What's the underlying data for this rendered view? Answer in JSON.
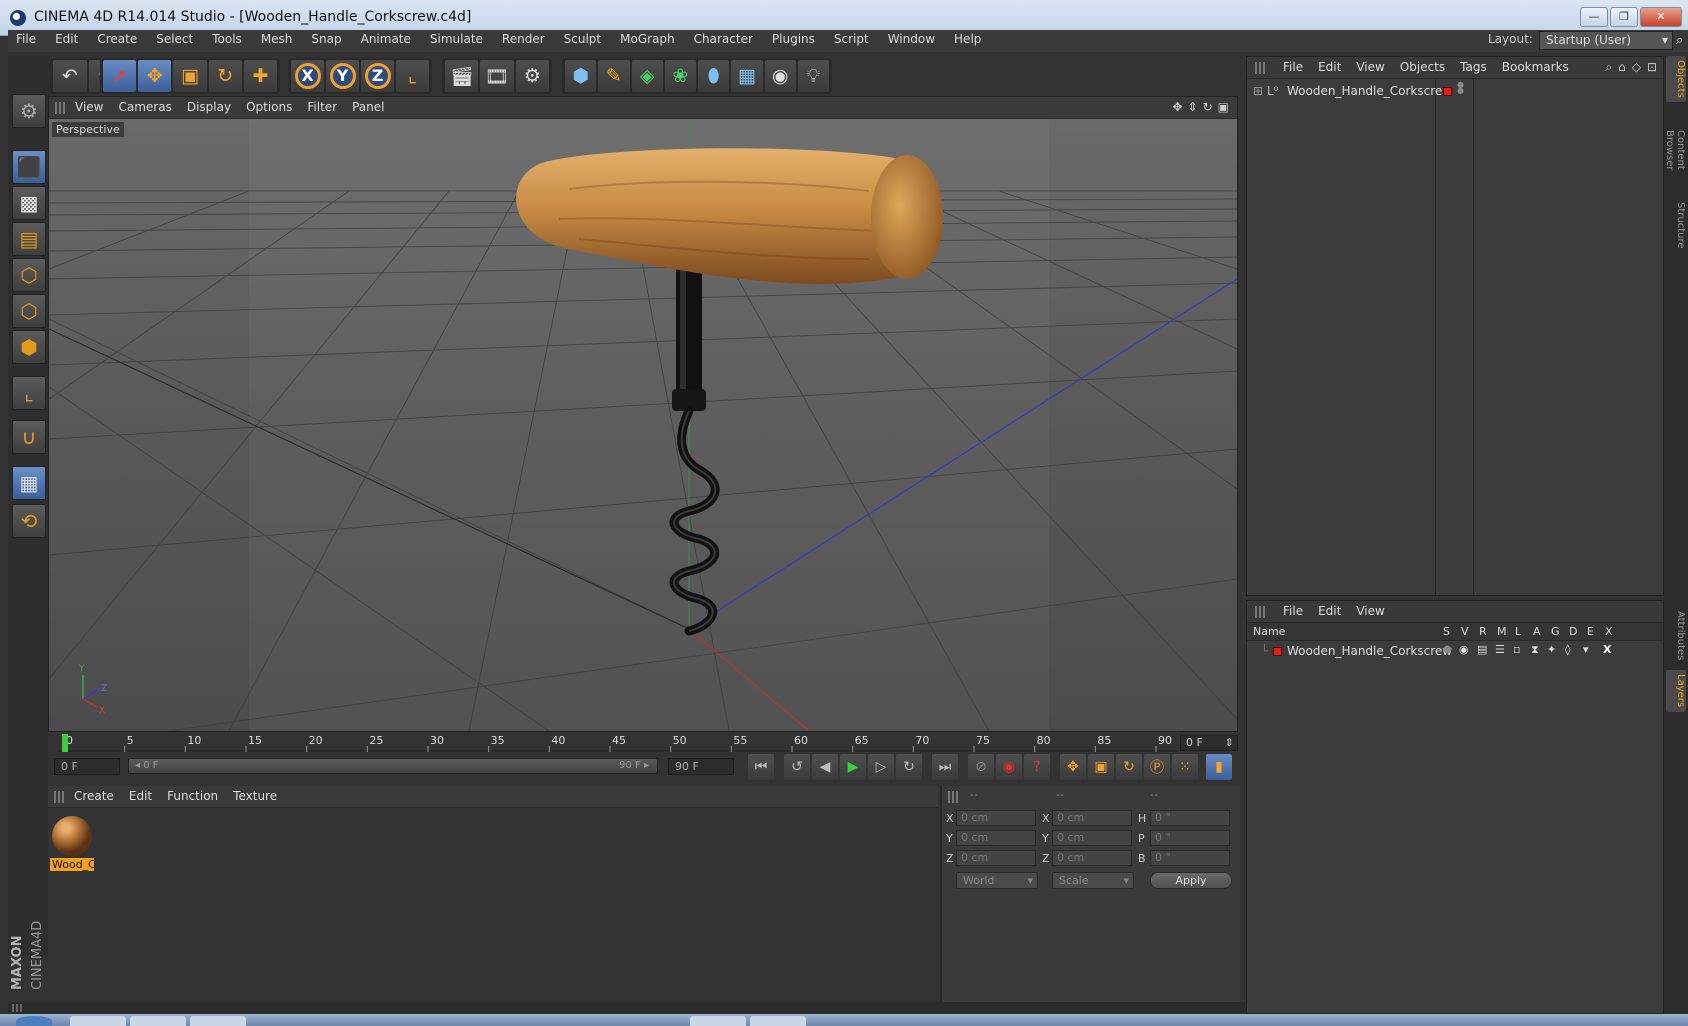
{
  "window": {
    "title": "CINEMA 4D R14.014 Studio - [Wooden_Handle_Corkscrew.c4d]",
    "buttons": [
      "—",
      "❐",
      "✕"
    ]
  },
  "menubar": {
    "items": [
      "File",
      "Edit",
      "Create",
      "Select",
      "Tools",
      "Mesh",
      "Snap",
      "Animate",
      "Simulate",
      "Render",
      "Sculpt",
      "MoGraph",
      "Character",
      "Plugins",
      "Script",
      "Window",
      "Help"
    ],
    "layout_label": "Layout:",
    "layout_value": "Startup (User)"
  },
  "toolbar": {
    "undo_icon": "↶",
    "redo_icon": "↷",
    "axis_x": "X",
    "axis_y": "Y",
    "axis_z": "Z"
  },
  "viewport": {
    "menu": [
      "View",
      "Cameras",
      "Display",
      "Options",
      "Filter",
      "Panel"
    ],
    "camera_label": "Perspective",
    "axis_y": "Y",
    "axis_z": "Z",
    "axis_x": "X"
  },
  "timeline": {
    "ticks": [
      "0",
      "5",
      "10",
      "15",
      "20",
      "25",
      "30",
      "35",
      "40",
      "45",
      "50",
      "55",
      "60",
      "65",
      "70",
      "75",
      "80",
      "85",
      "90"
    ],
    "current_frame": "0 F",
    "start_field": "0 F",
    "range_start": "◂ 0 F",
    "range_end": "90 F ▸",
    "end_field": "90 F"
  },
  "material_manager": {
    "menu": [
      "Create",
      "Edit",
      "Function",
      "Texture"
    ],
    "materials": [
      {
        "name": "Wood_C"
      }
    ]
  },
  "coordinates": {
    "headers": [
      "--",
      "--",
      "--"
    ],
    "rows": [
      {
        "p_label": "X",
        "p_value": "0 cm",
        "s_label": "X",
        "s_value": "0 cm",
        "r_label": "H",
        "r_value": "0 °"
      },
      {
        "p_label": "Y",
        "p_value": "0 cm",
        "s_label": "Y",
        "s_value": "0 cm",
        "r_label": "P",
        "r_value": "0 °"
      },
      {
        "p_label": "Z",
        "p_value": "0 cm",
        "s_label": "Z",
        "s_value": "0 cm",
        "r_label": "B",
        "r_value": "0 °"
      }
    ],
    "space": "World",
    "mode": "Scale",
    "apply": "Apply"
  },
  "object_manager": {
    "menu": [
      "File",
      "Edit",
      "View",
      "Objects",
      "Tags",
      "Bookmarks"
    ],
    "objects": [
      {
        "name": "Wooden_Handle_Corkscrew",
        "layer_color": "#e02020"
      }
    ]
  },
  "layer_manager": {
    "menu": [
      "File",
      "Edit",
      "View"
    ],
    "columns": [
      "Name",
      "S",
      "V",
      "R",
      "M",
      "L",
      "A",
      "G",
      "D",
      "E",
      "X"
    ],
    "layers": [
      {
        "name": "Wooden_Handle_Corkscrew",
        "color": "#e02020"
      }
    ]
  },
  "side_tabs": [
    "Objects",
    "Content Browser",
    "Structure",
    "Attributes",
    "Layers"
  ],
  "brand": {
    "line1": "MAXON",
    "line2": "CINEMA4D"
  },
  "colors": {
    "accent": "#f0a42b",
    "selection_blue": "#4d74b3",
    "wood": "#b97a3d"
  }
}
